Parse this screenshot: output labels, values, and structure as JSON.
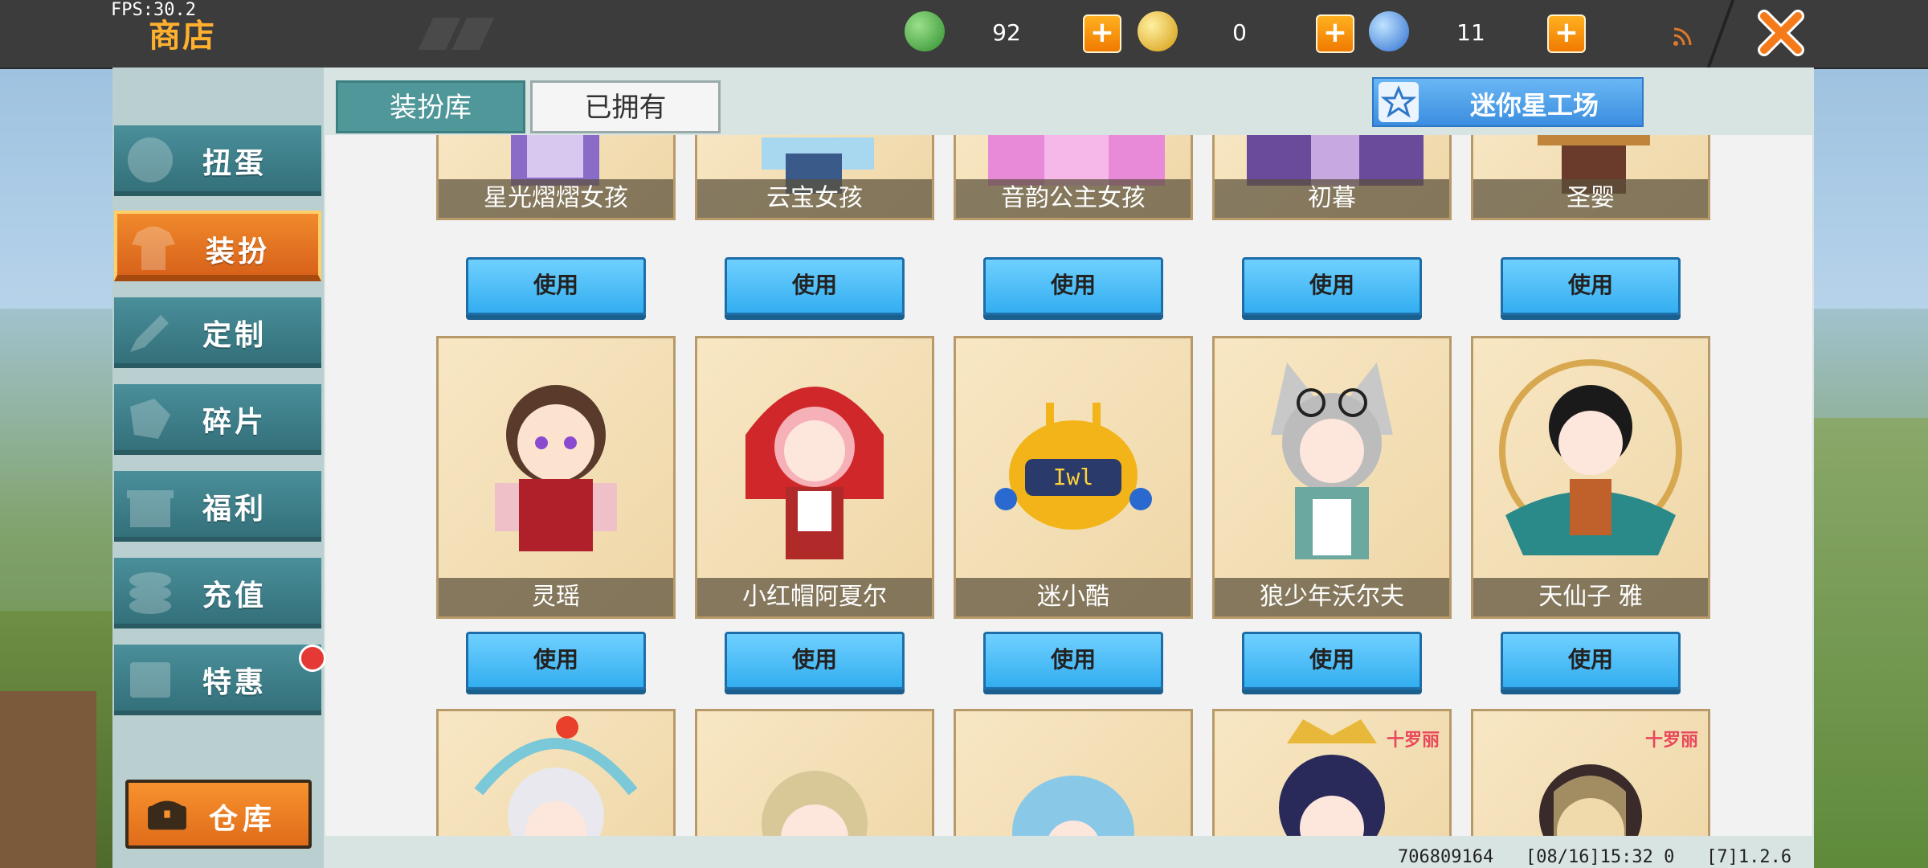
{
  "header": {
    "fps": "FPS:30.2",
    "title": "商店",
    "currencies": [
      {
        "name": "mini-bean-icon",
        "value": "92",
        "color": "#3fae3f"
      },
      {
        "name": "mini-coin-icon",
        "value": "0",
        "color": "#e6b82a"
      },
      {
        "name": "star-coin-icon",
        "value": "11",
        "color": "#3e8fe0"
      }
    ],
    "plus_label": "+"
  },
  "sidebar": {
    "items": [
      {
        "label": "扭蛋",
        "icon": "capsule-icon"
      },
      {
        "label": "装扮",
        "icon": "shirt-icon",
        "active": true
      },
      {
        "label": "定制",
        "icon": "pencil-icon"
      },
      {
        "label": "碎片",
        "icon": "fragment-icon"
      },
      {
        "label": "福利",
        "icon": "gift-icon"
      },
      {
        "label": "充值",
        "icon": "coins-icon"
      },
      {
        "label": "特惠",
        "icon": "discount-icon",
        "badge": true
      }
    ],
    "warehouse_label": "仓库"
  },
  "tabs": {
    "library": "装扮库",
    "owned": "已拥有"
  },
  "workshop_label": "迷你星工场",
  "use_label": "使用",
  "rows": [
    {
      "cards": [
        "星光熠熠女孩",
        "云宝女孩",
        "音韵公主女孩",
        "初暮",
        "圣婴"
      ]
    },
    {
      "cards": [
        "灵瑶",
        "小红帽阿夏尔",
        "迷小酷",
        "狼少年沃尔夫",
        "天仙子 雅"
      ]
    },
    {
      "cards": [
        "",
        "",
        "",
        "",
        ""
      ],
      "tags": [
        "",
        "",
        "",
        "十罗丽",
        "十罗丽"
      ]
    }
  ],
  "footer": {
    "uid": "706809164",
    "time": "[08/16]15:32 0",
    "version": "[7]1.2.6"
  }
}
